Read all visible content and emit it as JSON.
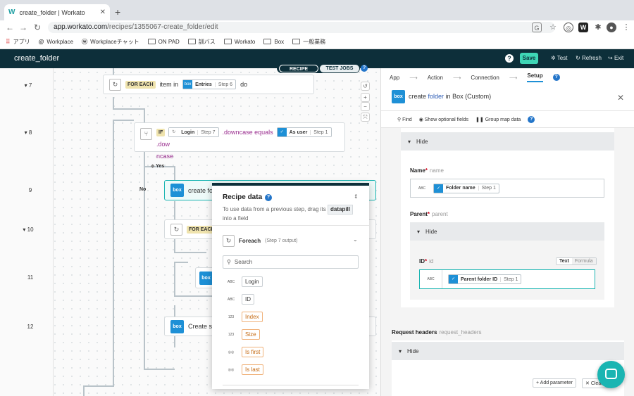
{
  "browser": {
    "tab_title": "create_folder | Workato",
    "tab_favicon": "W",
    "new_tab": "+",
    "url_host": "app.workato.com",
    "url_path": "/recipes/1355067-create_folder/edit",
    "bookmarks": [
      "アプリ",
      "Workplace",
      "Workplaceチャット",
      "ON PAD",
      "訓バス",
      "Workato",
      "Box",
      "一般業務"
    ]
  },
  "header": {
    "recipe_name": "create_folder",
    "help": "?",
    "save": "Save",
    "test": "Test",
    "refresh": "Refresh",
    "exit": "Exit"
  },
  "mode_toggle": {
    "recipe": "RECIPE",
    "test_jobs": "TEST JOBS"
  },
  "line_numbers": [
    "7",
    "8",
    "9",
    "10",
    "11",
    "12"
  ],
  "steps": {
    "foreach_kw": "FOR EACH",
    "foreach_item": "item in",
    "entries_pill": "Entries",
    "entries_step": "Step 6",
    "do": "do",
    "if_kw": "IF",
    "login_pill": "Login",
    "login_step": "Step 7",
    "downcase_equals": ".downcase equals",
    "asuser_pill": "As user",
    "asuser_step": "Step 1",
    "dow": ".dow",
    "ncase": "ncase",
    "yes": "Yes",
    "no": "No",
    "create_fol": "create fol",
    "foreach2": "FOR EACH",
    "create_sh": "Create sh",
    "box": "box"
  },
  "recipe_data": {
    "title": "Recipe data",
    "desc_1": "To use data from a previous step, drag its",
    "datapill": "datapill",
    "desc_2": "into a field",
    "source_name": "Foreach",
    "source_step": "(Step 7 output)",
    "search_placeholder": "Search",
    "fields": [
      {
        "type": "ABC",
        "name": "Login"
      },
      {
        "type": "ABC",
        "name": "ID"
      },
      {
        "type": "123",
        "name": "Index"
      },
      {
        "type": "123",
        "name": "Size"
      },
      {
        "type": "◎◎",
        "name": "Is first"
      },
      {
        "type": "◎◎",
        "name": "Is last"
      }
    ]
  },
  "right_panel": {
    "breadcrumbs": [
      "App",
      "Action",
      "Connection",
      "Setup"
    ],
    "title_prefix": "create",
    "title_folder": "folder",
    "title_suffix": "in Box (Custom)",
    "find": "Find",
    "show_optional": "Show optional fields",
    "group_map": "Group map data",
    "hide": "Hide",
    "name_label": "Name",
    "name_sub": "name",
    "abc": "ABC",
    "folder_name_pill": "Folder name",
    "folder_name_step": "Step 1",
    "parent_label": "Parent",
    "parent_sub": "parent",
    "id_label": "ID",
    "id_sub": "id",
    "text": "Text",
    "formula": "Formula",
    "parent_folder_pill": "Parent folder ID",
    "parent_folder_step": "Step 1",
    "request_headers": "Request headers",
    "request_headers_sub": "request_headers",
    "add_parameter": "+ Add parameter",
    "clear": "Clear"
  }
}
